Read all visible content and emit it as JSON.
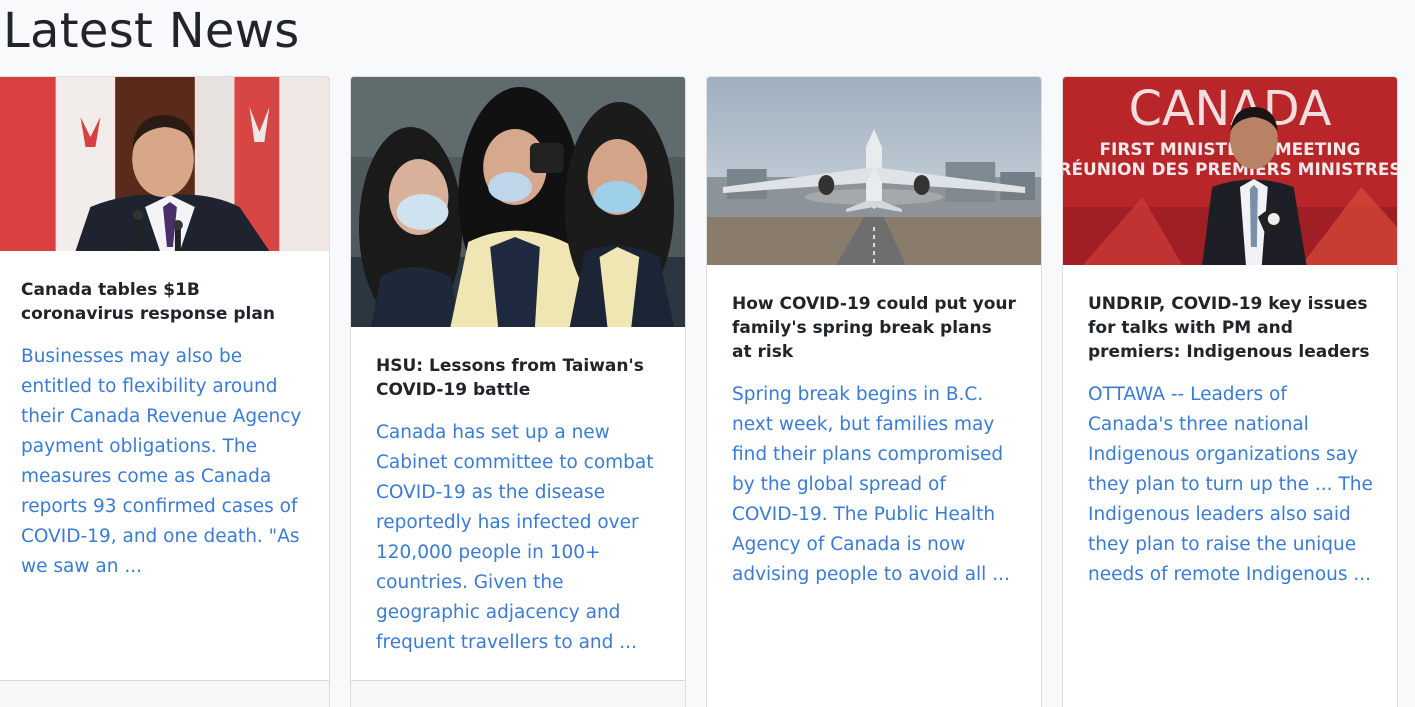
{
  "page": {
    "title": "Latest News"
  },
  "articles": [
    {
      "title": "Canada tables $1B coronavirus response plan",
      "summary": "Businesses may also be entitled to flexibility around their Canada Revenue Agency payment obligations. The measures come as Canada reports 93 confirmed cases of COVID-19, and one death. \"As we saw an ..."
    },
    {
      "title": "HSU: Lessons from Taiwan's COVID-19 battle",
      "summary": "Canada has set up a new Cabinet committee to combat COVID-19 as the disease reportedly has infected over 120,000 people in 100+ countries. Given the geographic adjacency and frequent travellers to and ..."
    },
    {
      "title": "How COVID-19 could put your family's spring break plans at risk",
      "summary": "Spring break begins in B.C. next week, but families may find their plans compromised by the global spread of COVID-19. The Public Health Agency of Canada is now advising people to avoid all ..."
    },
    {
      "title": "UNDRIP, COVID-19 key issues for talks with PM and premiers: Indigenous leaders",
      "summary": "OTTAWA -- Leaders of Canada's three national Indigenous organizations say they plan to turn up the ... The Indigenous leaders also said they plan to raise the unique needs of remote Indigenous ..."
    }
  ],
  "images": {
    "backdrop_sign": "CANADA",
    "backdrop_line_1": "FIRST MINISTERS' MEETING",
    "backdrop_line_2": "RÉUNION DES PREMIERS MINISTRES"
  },
  "colors": {
    "link": "#3a7bd5",
    "title": "#212529",
    "background": "#f8f9fa"
  }
}
